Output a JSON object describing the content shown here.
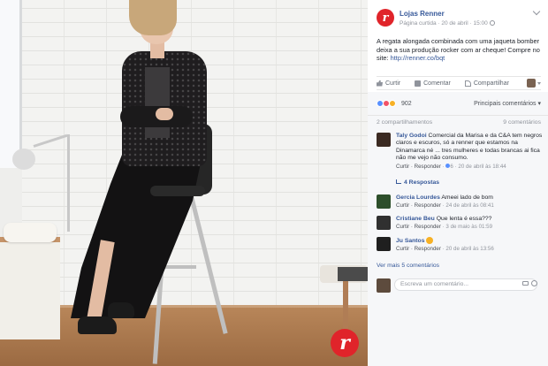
{
  "brand": {
    "badge_letter": "r",
    "accent_color": "#e0242a",
    "link_color": "#365899"
  },
  "post": {
    "page_name": "Lojas Renner",
    "meta": "Página curtida · 20 de abril · 15:00",
    "caption_text": "A regata alongada combinada com uma jaqueta bomber deixa a sua produção rocker com ar cheque! Compre no site: ",
    "caption_link": "http://renner.co/bqt",
    "actions": {
      "like": "Curtir",
      "comment": "Comentar",
      "share": "Compartilhar"
    },
    "reactions": {
      "count": "902",
      "filter_label": "Principais comentários ▾"
    },
    "shares": "2 compartilhamentos",
    "comments_count": "9 comentários"
  },
  "comments": [
    {
      "name": "Taly Godoi",
      "text": "Comercial da Marisa e da C&A tem negros claros e escuros, só a renner que estamos na Dinamarca né ... tres mulheres e todas brancas ai fica não me vejo não consumo.",
      "meta_action": "Curtir · Responder",
      "meta_likes": "6",
      "meta_date": "· 20 de abril às 18:44",
      "replies": "4 Respostas",
      "avatar_color": "#3b2a22"
    },
    {
      "name": "Gercia Lourdes",
      "text": "Ameei lado de bom",
      "meta_action": "Curtir · Responder",
      "meta_date": "· 24 de abril às 08:41",
      "avatar_color": "#2d4f2b"
    },
    {
      "name": "Cristiane Beu",
      "text": "Que lenta é essa???",
      "meta_action": "Curtir · Responder",
      "meta_date": "· 3 de maio às 01:59",
      "avatar_color": "#303030"
    },
    {
      "name": "Ju Santos",
      "text": "",
      "meta_action": "Curtir · Responder",
      "meta_date": "· 20 de abril às 13:56",
      "avatar_color": "#1f1f1f"
    }
  ],
  "more_comments": "Ver mais 5 comentários",
  "write_placeholder": "Escreva um comentário..."
}
